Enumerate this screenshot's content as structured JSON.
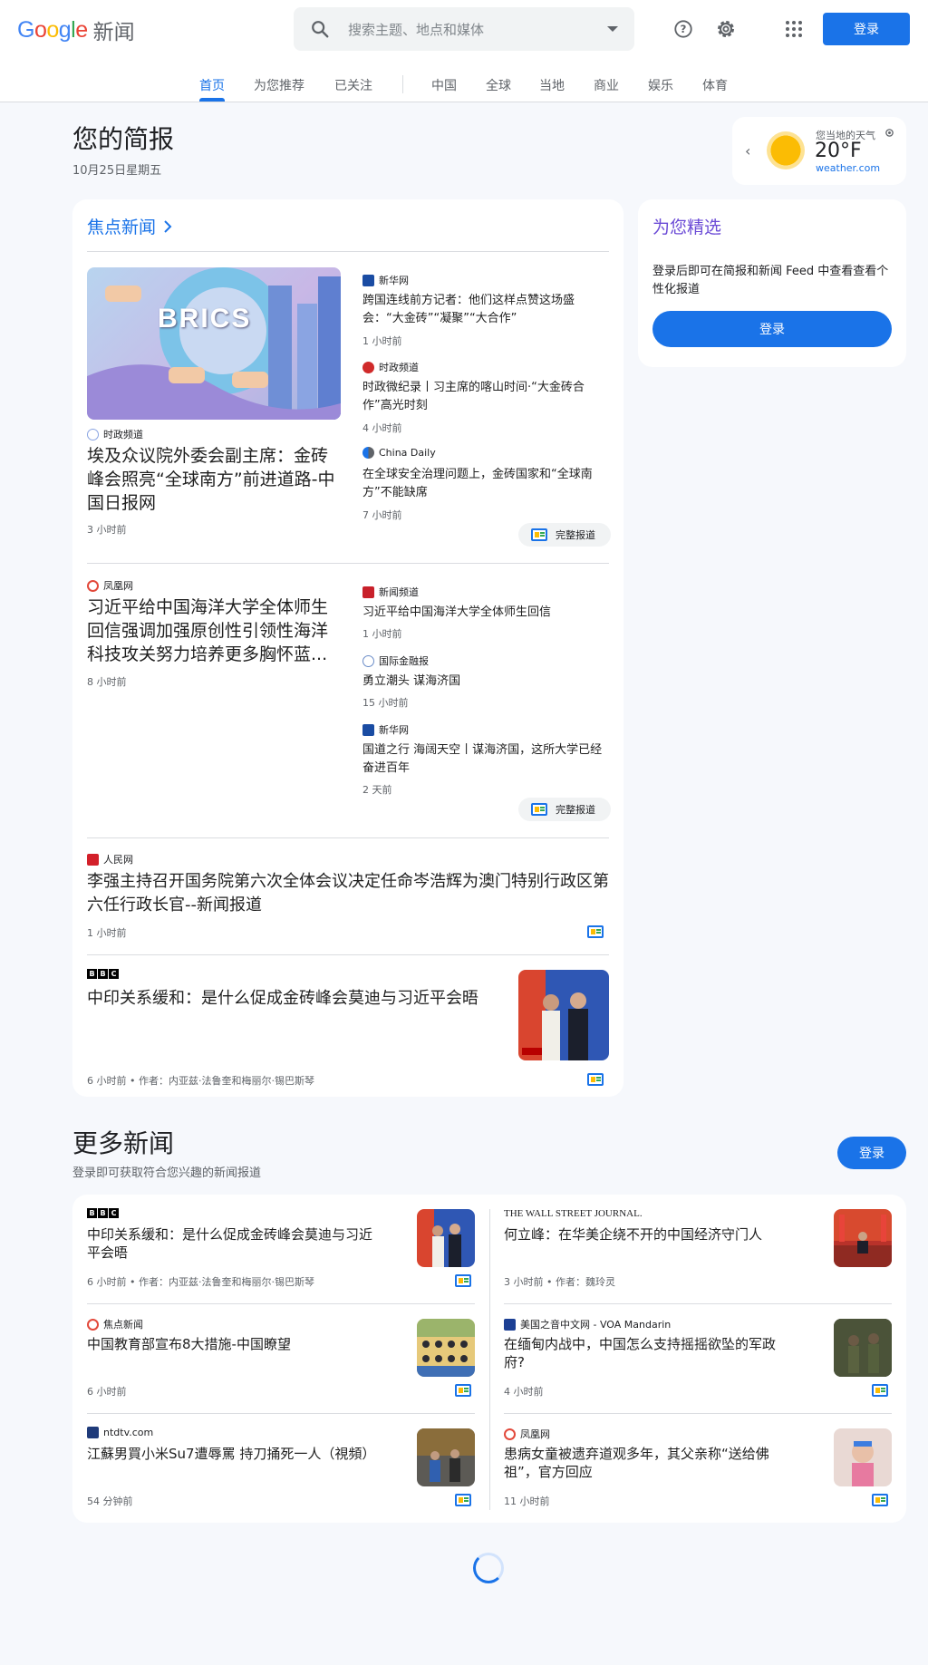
{
  "header": {
    "logo_google": "Google",
    "logo_news": "新闻",
    "search_placeholder": "搜索主题、地点和媒体",
    "signin_label": "登录",
    "tabs": [
      "首页",
      "为您推荐",
      "已关注",
      "中国",
      "全球",
      "当地",
      "商业",
      "娱乐",
      "体育"
    ]
  },
  "briefing": {
    "title": "您的简报",
    "date": "10月25日星期五"
  },
  "weather": {
    "label": "您当地的天气",
    "temp": "20°F",
    "source": "weather.com"
  },
  "focus": {
    "title": "焦点新闻",
    "full_coverage_label": "完整报道",
    "cluster1": {
      "main": {
        "source": "时政频道",
        "headline": "埃及众议院外委会副主席：金砖峰会照亮“全球南方”前进道路-中国日报网",
        "time": "3 小时前",
        "image_text": "BRICS"
      },
      "side": [
        {
          "source": "新华网",
          "headline": "跨国连线前方记者：他们这样点赞这场盛会：“大金砖”“凝聚”“大合作”",
          "time": "1 小时前"
        },
        {
          "source": "时政频道",
          "headline": "时政微纪录丨习主席的喀山时间·“大金砖合作”高光时刻",
          "time": "4 小时前"
        },
        {
          "source": "China Daily",
          "headline": "在全球安全治理问题上，金砖国家和“全球南方”不能缺席",
          "time": "7 小时前"
        }
      ]
    },
    "cluster2": {
      "main": {
        "source": "凤凰网",
        "headline": "习近平给中国海洋大学全体师生回信强调加强原创性引领性海洋科技攻关努力培养更多胸怀蓝...",
        "time": "8 小时前"
      },
      "side": [
        {
          "source": "新闻频道",
          "headline": "习近平给中国海洋大学全体师生回信",
          "time": "1 小时前"
        },
        {
          "source": "国际金融报",
          "headline": "勇立潮头 谋海济国",
          "time": "15 小时前"
        },
        {
          "source": "新华网",
          "headline": "国道之行 海阔天空丨谋海济国，这所大学已经奋进百年",
          "time": "2 天前"
        }
      ]
    },
    "story3": {
      "source": "人民网",
      "headline": "李强主持召开国务院第六次全体会议决定任命岑浩辉为澳门特别行政区第六任行政长官--新闻报道",
      "time": "1 小时前"
    },
    "story4": {
      "source": "BBC",
      "headline": "中印关系缓和：是什么促成金砖峰会莫迪与习近平会晤",
      "time": "6 小时前 • 作者：内亚兹·法鲁奎和梅丽尔·锡巴斯琴"
    }
  },
  "picks": {
    "title": "为您精选",
    "text": "登录后即可在简报和新闻 Feed 中查看查看个性化报道",
    "button": "登录"
  },
  "more": {
    "title": "更多新闻",
    "subtitle": "登录即可获取符合您兴趣的新闻报道",
    "button": "登录",
    "items": [
      {
        "source": "BBC",
        "headline": "中印关系缓和：是什么促成金砖峰会莫迪与习近平会晤",
        "time": "6 小时前 • 作者：内亚兹·法鲁奎和梅丽尔·锡巴斯琴"
      },
      {
        "source": "THE WALL STREET JOURNAL.",
        "headline": "何立峰：在华美企绕不开的中国经济守门人",
        "time": "3 小时前 • 作者：魏玲灵"
      },
      {
        "source": "焦点新闻",
        "headline": "中国教育部宣布8大措施-中国瞭望",
        "time": "6 小时前"
      },
      {
        "source": "美国之音中文网 - VOA Mandarin",
        "headline": "在缅甸内战中，中国怎么支持摇摇欲坠的军政府?",
        "time": "4 小时前"
      },
      {
        "source": "ntdtv.com",
        "headline": "江蘇男買小米Su7遭辱罵 持刀捅死一人（視頻）",
        "time": "54 分钟前"
      },
      {
        "source": "凤凰网",
        "headline": "患病女童被遗弃道观多年，其父亲称“送给佛祖”，官方回应",
        "time": "11 小时前"
      }
    ]
  },
  "colors": {
    "accent": "#1a73e8",
    "background": "#f6f8fc"
  }
}
